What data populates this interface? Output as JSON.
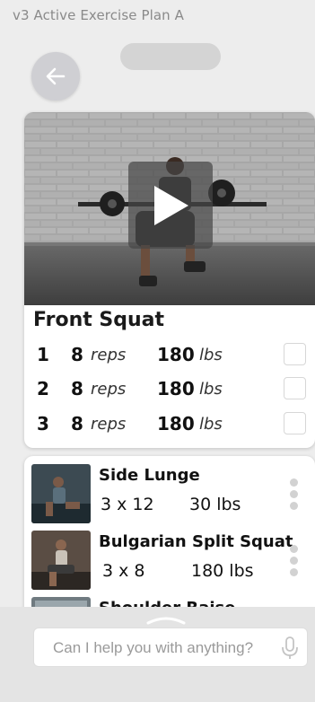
{
  "window": {
    "title": "v3 Active Exercise Plan A"
  },
  "icons": {
    "back": "arrow-left-icon",
    "play": "play-icon",
    "kebab": "kebab-menu-icon",
    "mic": "microphone-icon",
    "handle": "chevron-up-icon"
  },
  "current_exercise": {
    "name": "Front Squat",
    "sets": [
      {
        "number": "1",
        "reps": "8",
        "reps_unit": "reps",
        "weight": "180",
        "weight_unit": "lbs",
        "done": false
      },
      {
        "number": "2",
        "reps": "8",
        "reps_unit": "reps",
        "weight": "180",
        "weight_unit": "lbs",
        "done": false
      },
      {
        "number": "3",
        "reps": "8",
        "reps_unit": "reps",
        "weight": "180",
        "weight_unit": "lbs",
        "done": false
      }
    ]
  },
  "upcoming": [
    {
      "name": "Side Lunge",
      "sets_reps": "3 x 12",
      "weight": "30 lbs"
    },
    {
      "name": "Bulgarian Split Squat",
      "sets_reps": "3 x 8",
      "weight": "180 lbs"
    },
    {
      "name": "Shoulder Raise",
      "sets_reps": "",
      "weight": ""
    }
  ],
  "assistant": {
    "placeholder": "Can I help you with anything?"
  },
  "colors": {
    "background": "#ededed",
    "card": "#ffffff",
    "back_button": "#cfcfd3",
    "muted_text": "#8a8a8a"
  }
}
